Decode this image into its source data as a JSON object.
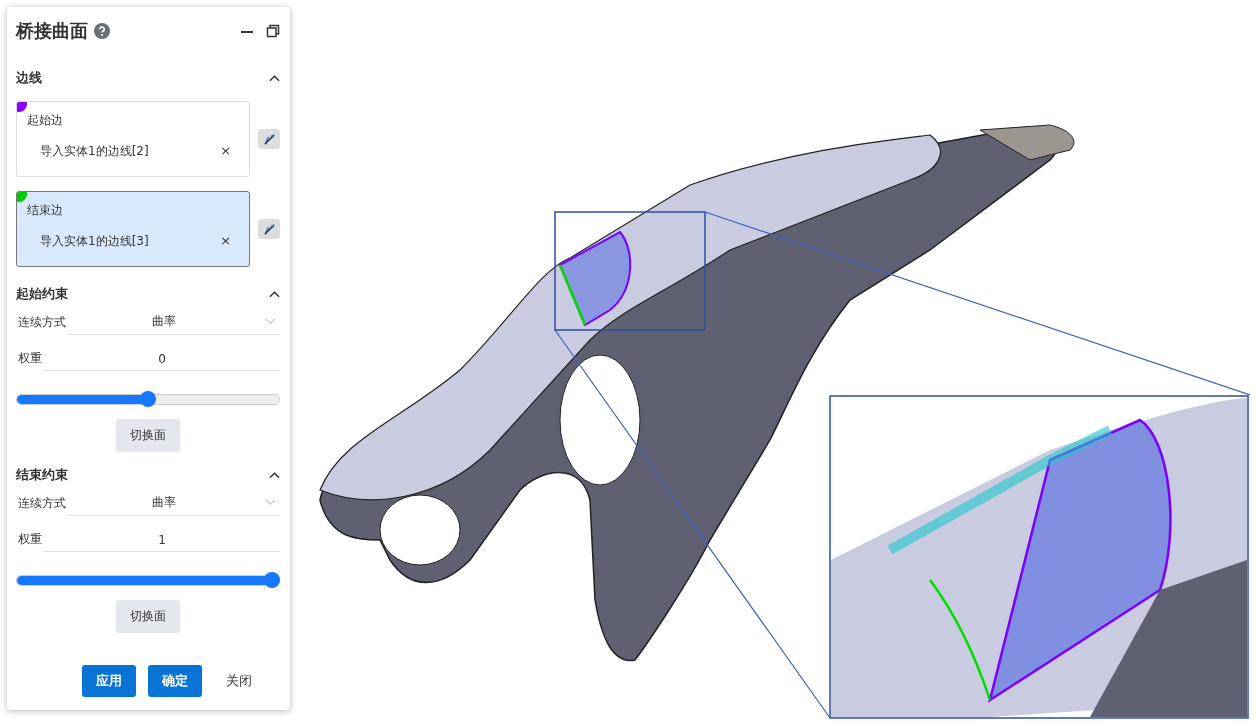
{
  "panel": {
    "title": "桥接曲面",
    "edges": {
      "title": "边线",
      "expanded": true,
      "items": [
        {
          "label": "起始边",
          "value": "导入实体1的边线[2]",
          "remove": "×",
          "color": "#8800ff",
          "selected": false
        },
        {
          "label": "结束边",
          "value": "导入实体1的边线[3]",
          "remove": "×",
          "color": "#00cc00",
          "selected": true
        }
      ]
    },
    "constraints": [
      {
        "title": "起始约束",
        "expanded": true,
        "continuity_label": "连续方式",
        "continuity": "曲率",
        "weight_label": "权重",
        "weight": "0",
        "level": 0.5,
        "switch_button": "切换面"
      },
      {
        "title": "结束约束",
        "expanded": true,
        "continuity_label": "连续方式",
        "continuity": "曲率",
        "weight_label": "权重",
        "weight": "1",
        "level": 1,
        "switch_button": "切换面"
      }
    ],
    "buttons": [
      {
        "label": "应用",
        "kind": "primary"
      },
      {
        "label": "确定",
        "kind": "primary"
      },
      {
        "label": "关闭",
        "kind": "text"
      }
    ]
  }
}
